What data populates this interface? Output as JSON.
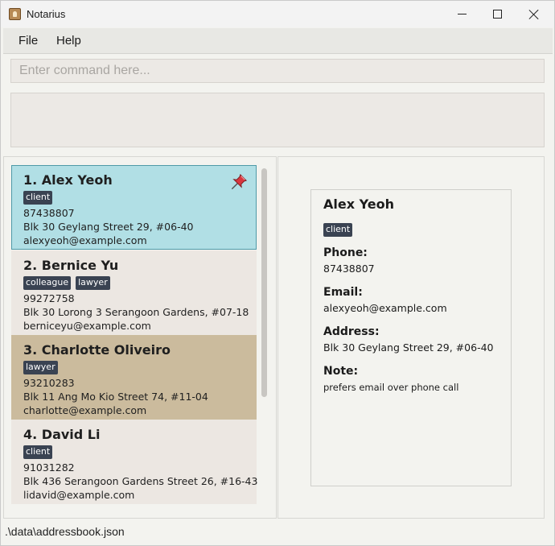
{
  "window": {
    "title": "Notarius"
  },
  "menu": {
    "file": "File",
    "help": "Help"
  },
  "command": {
    "placeholder": "Enter command here...",
    "value": ""
  },
  "result": {
    "text": ""
  },
  "persons": [
    {
      "index_name": "1. Alex Yeoh",
      "tags": [
        "client"
      ],
      "phone": "87438807",
      "address": "Blk 30 Geylang Street 29, #06-40",
      "email": "alexyeoh@example.com",
      "pinned": true,
      "selected": true,
      "bg": "#b1dfe5"
    },
    {
      "index_name": "2. Bernice Yu",
      "tags": [
        "colleague",
        "lawyer"
      ],
      "phone": "99272758",
      "address": "Blk 30 Lorong 3 Serangoon Gardens, #07-18",
      "email": "berniceyu@example.com",
      "pinned": false,
      "selected": false,
      "bg": "#ece7e2"
    },
    {
      "index_name": "3. Charlotte Oliveiro",
      "tags": [
        "lawyer"
      ],
      "phone": "93210283",
      "address": "Blk 11 Ang Mo Kio Street 74, #11-04",
      "email": "charlotte@example.com",
      "pinned": false,
      "selected": false,
      "bg": "#cbbb9d"
    },
    {
      "index_name": "4. David Li",
      "tags": [
        "client"
      ],
      "phone": "91031282",
      "address": "Blk 436 Serangoon Gardens Street 26, #16-43",
      "email": "lidavid@example.com",
      "pinned": false,
      "selected": false,
      "bg": "#ece7e2"
    }
  ],
  "detail": {
    "name": "Alex Yeoh",
    "tags": [
      "client"
    ],
    "phone_label": "Phone:",
    "phone": "87438807",
    "email_label": "Email:",
    "email": "alexyeoh@example.com",
    "address_label": "Address:",
    "address": "Blk 30 Geylang Street 29, #06-40",
    "note_label": "Note:",
    "note": "prefers email over phone call"
  },
  "status": {
    "file_path": ".\\data\\addressbook.json"
  },
  "colors": {
    "selected_border": "#4f9aa8",
    "tag_bg": "#3a4352",
    "pin_red": "#d9363e"
  }
}
